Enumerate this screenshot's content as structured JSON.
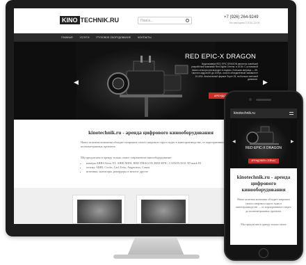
{
  "desktop": {
    "logo": {
      "box": "KINO",
      "text": "TECHNIK.RU"
    },
    "search": {
      "placeholder": "Поиск..."
    },
    "phone": "+7 (926) 264-9249",
    "hours": "Без выходных 10:00–22:00",
    "nav": [
      "ГЛАВНАЯ",
      "УСЛУГИ",
      "ГРУЗОВОЕ ОБОРУДОВАНИЕ",
      "КОНТАКТЫ"
    ],
    "hero": {
      "title": "RED EPIC-X DRAGON",
      "text": "Видеокамера RED EPIC DRAGON является новейшей разработкой компании Red Digital Cinema. в 2016г. С установкой нового сенсора она выходит в лидеры. Большая матрица — 6K. Частота кадров 6K до 100fps, сильно объединённый эквивалент 24 ASA. Аналогичный формат Super 35, на больше световой диапазон.",
      "button": "АРЕНДОВАТЬ СЕЙЧАС"
    },
    "content": {
      "title": "kinotechnik.ru - аренда цифрового кинооборудования",
      "para1": "Наша халатная компания обладает широким самого широкого круга задач в кинопроизводстве, от корпоративного видео до полнометражных проектов.",
      "para2": "Мы предлагаем в аренду только самое современное кинооборудование:",
      "bullets": [
        "камеры ARRI Alexa XT, ARRI MINI, RED DRAGON, RED EPIC, CANON EOS 5D mark III",
        "оптику ARRI, Cooke, Carl Zeiss, Angenieux, Canon",
        "штативы, мониторы, рекордеры и многое другое"
      ]
    }
  },
  "mobile": {
    "site_title": "kinotechnik.ru",
    "hero": {
      "title": "RED EPIC-X DRAGON",
      "button": "АРЕНДОВАТЬ СЕЙЧАС"
    },
    "headline": "kinotechnik.ru - аренда цифрового кинооборудования",
    "para1": "Наша халатная компания обладает широким самого широкого круга задач в кинопроизводстве — от корпоративного видео до полнометражных проектов.",
    "para2": "Мы предлагаем в аренду только самое"
  }
}
